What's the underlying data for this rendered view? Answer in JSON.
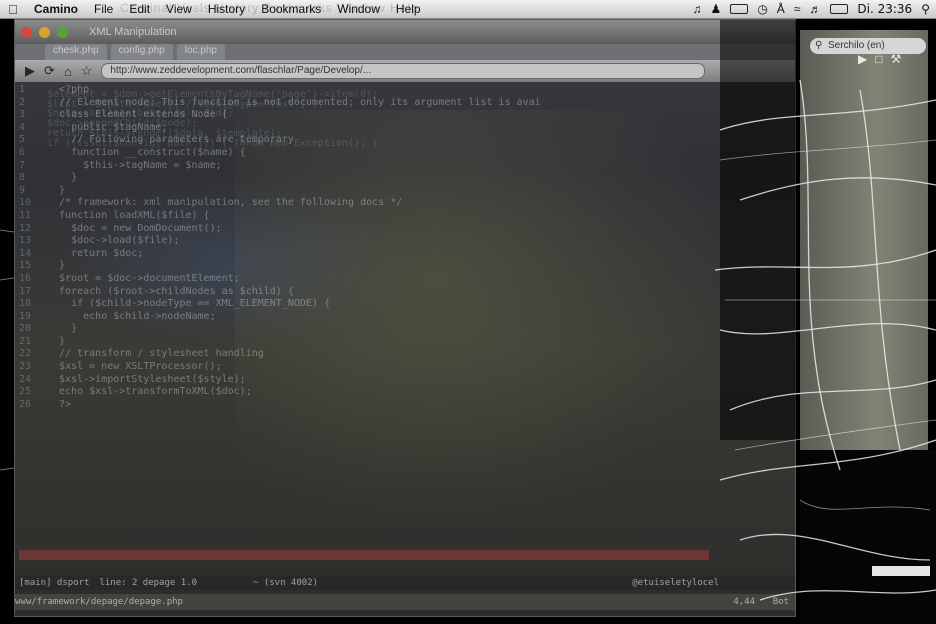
{
  "menubar": {
    "app_name": "Camino",
    "items": [
      "File",
      "Edit",
      "View",
      "History",
      "Bookmarks",
      "Window",
      "Help"
    ],
    "ghost_text": "Cardinal Vosls History Bookmarks Window Help",
    "clock": "Di. 23:36",
    "icons": [
      "apple-icon",
      "music-note-icon",
      "user-icon",
      "battery-icon",
      "time-machine-icon",
      "bluetooth-icon",
      "wifi-icon",
      "volume-icon",
      "battery-status-icon",
      "search-icon"
    ]
  },
  "window": {
    "title": "XML Manipulation",
    "tabs": [
      "chesk.php",
      "config.php",
      "loc.php"
    ],
    "url": "http://www.zeddevelopment.com/flaschlar/Page/Develop/..."
  },
  "code_lines": [
    "   <?php",
    "   // Element node: This function is not documented; only its argument list is avai",
    "   class Element extends Node {",
    "     public $tagName;",
    "     // Following parameters are temporary",
    "     function __construct($name) {",
    "       $this->tagName = $name;",
    "     }",
    "   }",
    "   /* framework: xml manipulation, see the following docs */",
    "   function loadXML($file) {",
    "     $doc = new DomDocument();",
    "     $doc->load($file);",
    "     return $doc;",
    "   }",
    "   $root = $doc->documentElement;",
    "   foreach ($root->childNodes as $child) {",
    "     if ($child->nodeType == XML_ELEMENT_NODE) {",
    "       echo $child->nodeName;",
    "     }",
    "   }",
    "   // transform / stylesheet handling",
    "   $xsl = new XSLTProcessor();",
    "   $xsl->importStylesheet($style);",
    "   echo $xsl->transformToXML($doc);",
    "   ?>"
  ],
  "ghost_lines": [
    "$element = $dom->getElementsByTagName('page')->item(0);",
    "$list = $xpath->query('//item[@type=\"text\"]');",
    "$node->setAttribute('id', $id);",
    "$doc->appendChild($node);",
    "return $this->render($data, $template);",
    "if (!isset($config['path'])) { throw new Exception(); }"
  ],
  "statusline": {
    "left": "[main] dsport",
    "mid": "line: 2 depage 1.0",
    "mode": "",
    "center": "~ (svn 4002)",
    "right": "@etuiseletylocel"
  },
  "bottompath": {
    "path": "www/framework/depage/depage.php",
    "pos": "4,44",
    "all": "Bot"
  },
  "right_panel": {
    "search_placeholder": "Serchilo (en)"
  }
}
